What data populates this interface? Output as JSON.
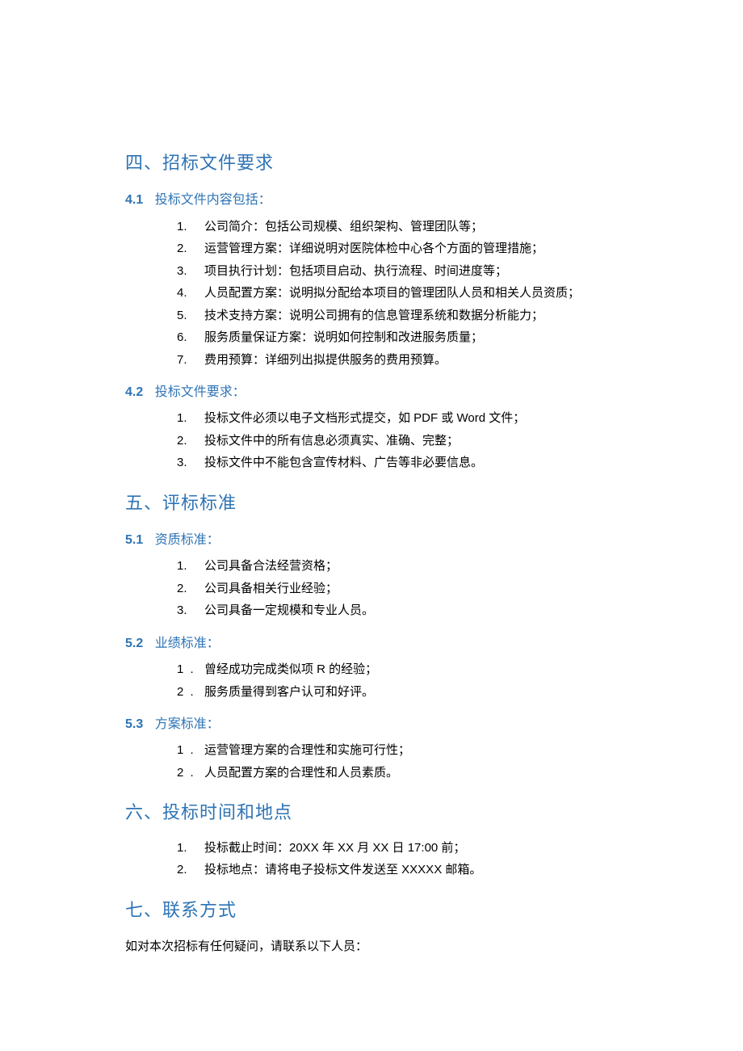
{
  "section4": {
    "title": "四、招标文件要求",
    "sub1": {
      "num": "4.1",
      "label": "投标文件内容包括：",
      "items": [
        "公司简介：包括公司规模、组织架构、管理团队等；",
        "运营管理方案：详细说明对医院体检中心各个方面的管理措施；",
        "项目执行计划：包括项目启动、执行流程、时间进度等；",
        "人员配置方案：说明拟分配给本项目的管理团队人员和相关人员资质；",
        "技术支持方案：说明公司拥有的信息管理系统和数据分析能力；",
        "服务质量保证方案：说明如何控制和改进服务质量；",
        "费用预算：详细列出拟提供服务的费用预算。"
      ]
    },
    "sub2": {
      "num": "4.2",
      "label": "投标文件要求：",
      "items": [
        "投标文件必须以电子文档形式提交，如 PDF 或 Word 文件；",
        "投标文件中的所有信息必须真实、准确、完整；",
        "投标文件中不能包含宣传材料、广告等非必要信息。"
      ]
    }
  },
  "section5": {
    "title": "五、评标标准",
    "sub1": {
      "num": "5.1",
      "label": "资质标准：",
      "items": [
        "公司具备合法经营资格；",
        "公司具备相关行业经验；",
        "公司具备一定规模和专业人员。"
      ]
    },
    "sub2": {
      "num": "5.2",
      "label": "业绩标准：",
      "items": [
        "曾经成功完成类似项 R 的经验；",
        "服务质量得到客户认可和好评。"
      ]
    },
    "sub3": {
      "num": "5.3",
      "label": "方案标准：",
      "items": [
        "运营管理方案的合理性和实施可行性；",
        "人员配置方案的合理性和人员素质。"
      ]
    }
  },
  "section6": {
    "title": "六、投标时间和地点",
    "items": [
      "投标截止时间：20XX 年 XX 月 XX 日 17:00 前；",
      "投标地点：请将电子投标文件发送至 XXXXX 邮箱。"
    ]
  },
  "section7": {
    "title": "七、联系方式",
    "paragraph": "如对本次招标有任何疑问，请联系以下人员："
  },
  "markers": {
    "m1": "1.",
    "m2": "2.",
    "m3": "3.",
    "m4": "4.",
    "m5": "5.",
    "m6": "6.",
    "m7": "7.",
    "a1": "1 .",
    "a2": "2 .",
    "a3": "3 ."
  }
}
